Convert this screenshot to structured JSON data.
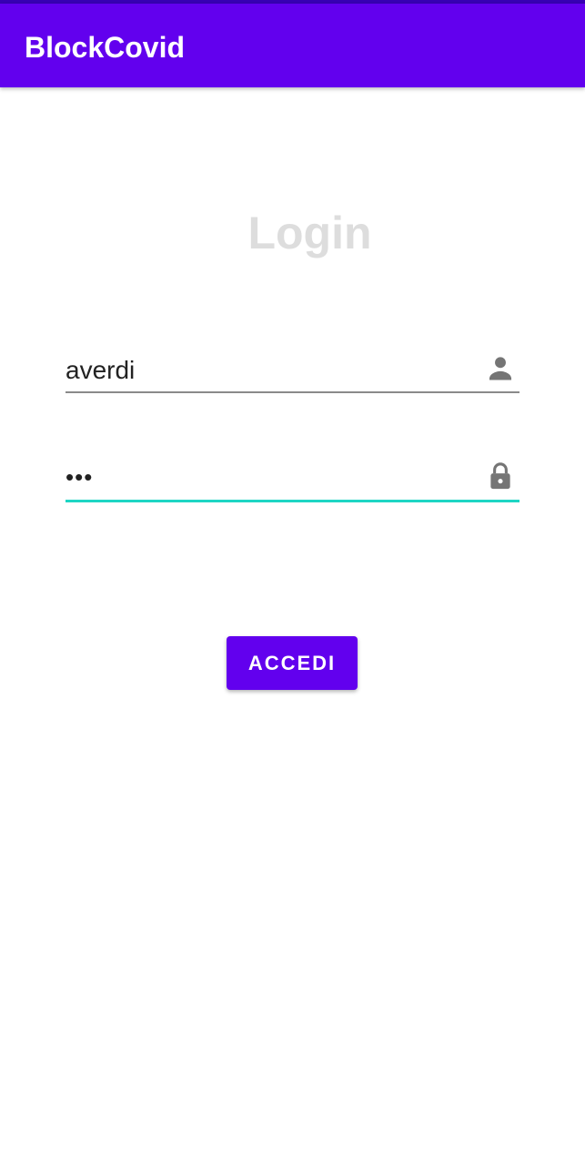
{
  "app_bar": {
    "title": "BlockCovid",
    "color": "#6200ee",
    "status_strip_color": "#3700b3"
  },
  "login": {
    "heading": "Login",
    "username": {
      "value": "averdi",
      "icon": "person-icon"
    },
    "password": {
      "value": "•••",
      "icon": "lock-icon",
      "focused": true,
      "accent_color": "#1ed6c4"
    },
    "submit_label": "ACCEDI"
  }
}
